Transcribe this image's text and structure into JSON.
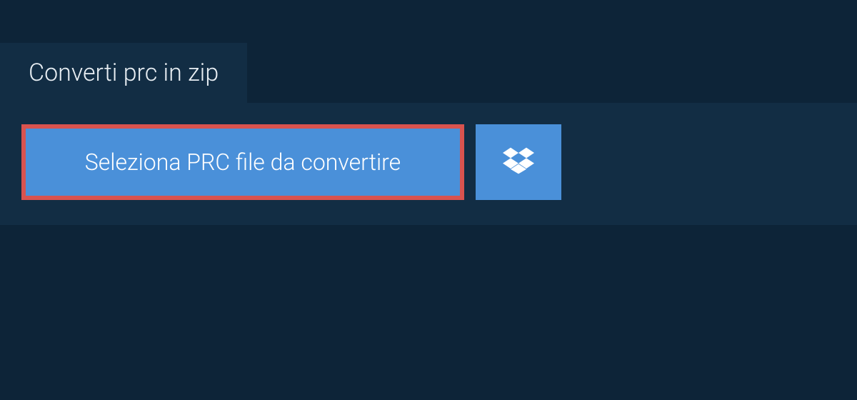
{
  "tab": {
    "title": "Converti prc in zip"
  },
  "actions": {
    "select_file_label": "Seleziona PRC file da convertire"
  },
  "colors": {
    "background": "#0d2438",
    "panel": "#122d44",
    "button": "#4a90d9",
    "highlight_border": "#d9534f",
    "text_light": "#e8eef3",
    "text_white": "#ffffff"
  }
}
